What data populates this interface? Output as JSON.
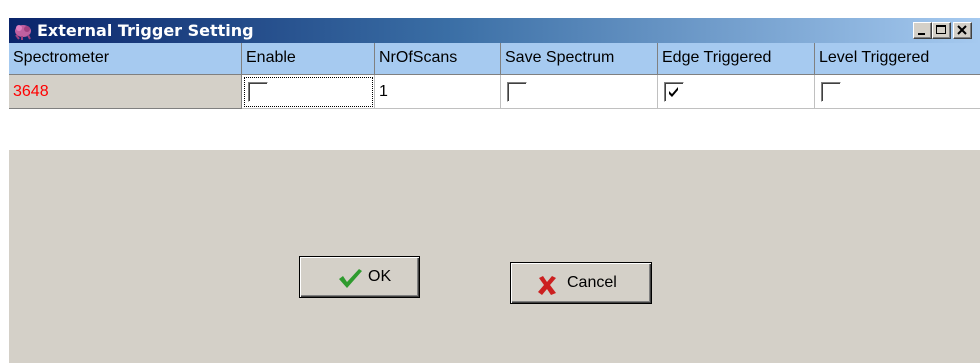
{
  "window": {
    "title": "External Trigger Setting",
    "icon": "app-icon",
    "controls": {
      "minimize": "minimize-icon",
      "maximize": "maximize-icon",
      "close": "close-icon"
    }
  },
  "grid": {
    "columns": [
      "Spectrometer",
      "Enable",
      "NrOfScans",
      "Save Spectrum",
      "Edge Triggered",
      "Level Triggered"
    ],
    "rows": [
      {
        "spectrometer": "3648",
        "enable": false,
        "nr_of_scans": "1",
        "save_spectrum": false,
        "edge_triggered": true,
        "level_triggered": false
      }
    ]
  },
  "buttons": {
    "ok": {
      "label": "OK",
      "icon": "checkmark-icon"
    },
    "cancel": {
      "label": "Cancel",
      "icon": "x-icon"
    }
  },
  "colors": {
    "title_gradient_start": "#0a246a",
    "title_gradient_end": "#a6caf0",
    "header_bg": "#a6caf0",
    "spectrometer_text": "#ff0000",
    "ok_icon": "#2e9b2e",
    "cancel_icon": "#cc2020"
  }
}
